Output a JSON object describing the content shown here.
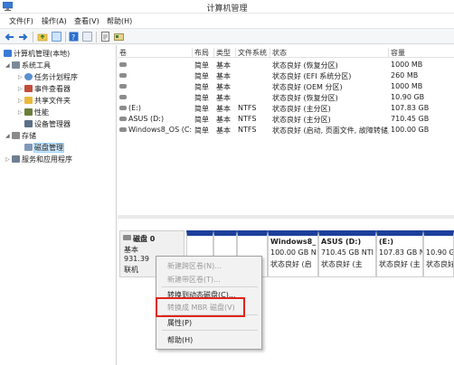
{
  "window": {
    "title": "计算机管理"
  },
  "menu": [
    "文件(F)",
    "操作(A)",
    "查看(V)",
    "帮助(H)"
  ],
  "toolbar": {
    "icons": [
      "back-arrow-icon",
      "forward-arrow-icon",
      "folder-up-icon",
      "console-tree-icon",
      "help-icon",
      "properties-icon",
      "export-icon",
      "disk-settings-icon"
    ]
  },
  "tree": {
    "root": "计算机管理(本地)",
    "system_tools": "系统工具",
    "task_scheduler": "任务计划程序",
    "event_viewer": "事件查看器",
    "shared_folders": "共享文件夹",
    "performance": "性能",
    "device_manager": "设备管理器",
    "storage": "存储",
    "disk_management": "磁盘管理",
    "services_apps": "服务和应用程序"
  },
  "list": {
    "headers": [
      "卷",
      "布局",
      "类型",
      "文件系统",
      "状态",
      "容量"
    ],
    "rows": [
      [
        "",
        "简单",
        "基本",
        "",
        "状态良好 (恢复分区)",
        "1000 MB"
      ],
      [
        "",
        "简单",
        "基本",
        "",
        "状态良好 (EFI 系统分区)",
        "260 MB"
      ],
      [
        "",
        "简单",
        "基本",
        "",
        "状态良好 (OEM 分区)",
        "1000 MB"
      ],
      [
        "",
        "简单",
        "基本",
        "",
        "状态良好 (恢复分区)",
        "10.90 GB"
      ],
      [
        "(E:)",
        "简单",
        "基本",
        "NTFS",
        "状态良好 (主分区)",
        "107.83 GB"
      ],
      [
        "ASUS (D:)",
        "简单",
        "基本",
        "NTFS",
        "状态良好 (主分区)",
        "710.45 GB"
      ],
      [
        "Windows8_OS (C:)",
        "简单",
        "基本",
        "NTFS",
        "状态良好 (启动, 页面文件, 故障转储, 主分区)",
        "100.00 GB"
      ]
    ]
  },
  "disk": {
    "name": "磁盘 0",
    "type": "基本",
    "size": "931.39",
    "status": "联机",
    "partitions": [
      {
        "name": "",
        "size": "",
        "status": ""
      },
      {
        "name": "",
        "size": "",
        "status": ""
      },
      {
        "name": "",
        "size": "",
        "status": ""
      },
      {
        "name": "Windows8_",
        "size": "100.00 GB N",
        "status": "状态良好 (启"
      },
      {
        "name": "ASUS (D:)",
        "size": "710.45 GB NTI",
        "status": "状态良好 (主"
      },
      {
        "name": "(E:)",
        "size": "107.83 GB N",
        "status": "状态良好 (主"
      },
      {
        "name": "",
        "size": "10.90 GB",
        "status": "状态良好 ("
      }
    ]
  },
  "context_menu": {
    "new_spanned": "新建跨区卷(N)...",
    "new_striped": "新建带区卷(T)...",
    "convert_dynamic": "转换到动态磁盘(C)...",
    "convert_mbr": "转换成 MBR 磁盘(V)",
    "properties": "属性(P)",
    "help": "帮助(H)"
  },
  "colors": {
    "partition_bar": "#1d3f9b",
    "highlight": "#e2231a",
    "selection": "#cde8ff"
  }
}
